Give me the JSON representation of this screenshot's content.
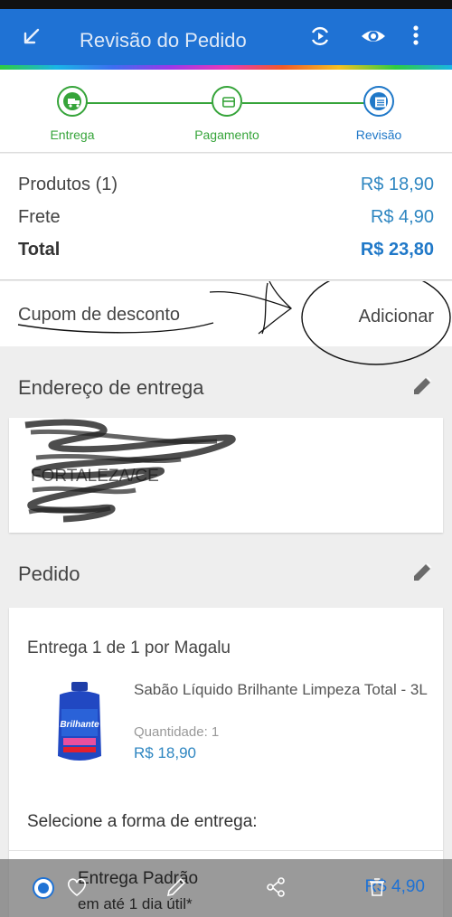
{
  "appbar": {
    "title": "Revisão do Pedido",
    "back_icon": "arrow-back-icon",
    "actions": [
      "sync-icon",
      "eye-icon",
      "more-vert-icon"
    ],
    "color": "#1f72d4"
  },
  "steps": [
    {
      "label": "Entrega",
      "icon": "truck-icon",
      "state": "done"
    },
    {
      "label": "Pagamento",
      "icon": "card-icon",
      "state": "done"
    },
    {
      "label": "Revisão",
      "icon": "list-icon",
      "state": "current"
    }
  ],
  "summary": {
    "products_label": "Produtos (1)",
    "products_value": "R$ 18,90",
    "shipping_label": "Frete",
    "shipping_value": "R$ 4,90",
    "total_label": "Total",
    "total_value": "R$ 23,80"
  },
  "coupon": {
    "label": "Cupom de desconto",
    "action": "Adicionar"
  },
  "address": {
    "title": "Endereço de entrega",
    "line2_visible": "FORTALEZA/CE"
  },
  "order": {
    "title": "Pedido",
    "delivery_label": "Entrega 1 de 1 por Magalu",
    "product_name": "Sabão Líquido Brilhante Limpeza Total - 3L",
    "quantity_label": "Quantidade:",
    "quantity_value": "1",
    "product_price": "R$ 18,90",
    "select_shipping_label": "Selecione a forma de entrega:"
  },
  "shipping_option": {
    "name": "Entrega Padrão",
    "eta": "em até 1 dia útil*",
    "price": "R$ 4,90",
    "selected": true
  },
  "bottom_nav_icons": [
    "heart-icon",
    "pencil-icon",
    "share-icon",
    "trash-icon"
  ],
  "colors": {
    "step_green": "#36a43a",
    "price_blue": "#2e86c1"
  }
}
